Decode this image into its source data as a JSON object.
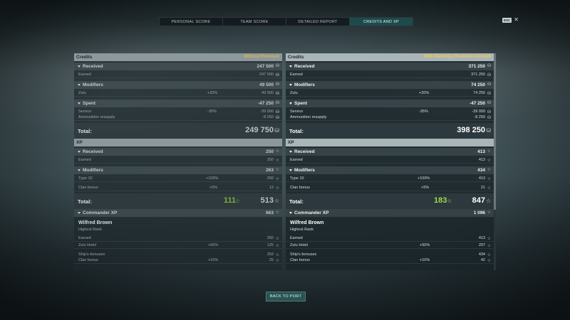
{
  "tabs": [
    "PERSONAL SCORE",
    "TEAM SCORE",
    "DETAILED REPORT",
    "CREDITS AND XP"
  ],
  "active_tab": 3,
  "close": {
    "key": "ESC",
    "icon": "close-icon",
    "symbol": "✕"
  },
  "icons": {
    "credits": "credits-icon",
    "xp": "star-icon"
  },
  "colors": {
    "premium_tag": "#f0c94a",
    "bonus_xp": "#9ed84a",
    "active_tab": "#1d4a4a"
  },
  "left": {
    "credits_header": "Credits",
    "credits_tag": "Without Premium",
    "received": {
      "label": "Received",
      "value": "247 500"
    },
    "earned": {
      "label": "Earned",
      "value": "247 500"
    },
    "modifiers": {
      "label": "Modifiers",
      "value": "49 500"
    },
    "zulu": {
      "label": "Zulu",
      "pct": "+20%",
      "value": "49 500"
    },
    "spent": {
      "label": "Spent",
      "value": "-47 250"
    },
    "service": {
      "label": "Service",
      "pct": "-35%",
      "value": "-39 000"
    },
    "ammo": {
      "label": "Ammunition resupply",
      "value": "-8 250"
    },
    "credits_total": {
      "label": "Total:",
      "value": "249 750"
    },
    "xp_header": "XP",
    "xp_received": {
      "label": "Received",
      "value": "250"
    },
    "xp_earned": {
      "label": "Earned",
      "value": "250"
    },
    "xp_modifiers": {
      "label": "Modifiers",
      "value": "263"
    },
    "type10": {
      "label": "Type 10",
      "pct": "+100%",
      "value": "250"
    },
    "clan": {
      "label": "Clan bonus",
      "pct": "+5%",
      "value": "13"
    },
    "xp_total": {
      "label": "Total:",
      "bonus": "111",
      "value": "513"
    },
    "cmd": {
      "label": "Commander XP",
      "value": "663"
    },
    "cmd_name": "Wilfred Brown",
    "cmd_rank": "Highest Rank",
    "cmd_earned": {
      "label": "Earned",
      "value": "250"
    },
    "cmd_zulu": {
      "label": "Zulu Hotel",
      "pct": "+50%",
      "value": "125"
    },
    "ship_bonus": {
      "label": "Ship's bonuses",
      "value": "263"
    },
    "cmd_clan": {
      "label": "Clan bonus",
      "pct": "+10%",
      "value": "25"
    }
  },
  "right": {
    "credits_header": "Credits",
    "credits_tag": "With Warships Premium Account",
    "received": {
      "label": "Received",
      "value": "371 250"
    },
    "earned": {
      "label": "Earned",
      "value": "371 250"
    },
    "modifiers": {
      "label": "Modifiers",
      "value": "74 250"
    },
    "zulu": {
      "label": "Zulu",
      "pct": "+20%",
      "value": "74 250"
    },
    "spent": {
      "label": "Spent",
      "value": "-47 250"
    },
    "service": {
      "label": "Service",
      "pct": "-35%",
      "value": "-39 000"
    },
    "ammo": {
      "label": "Ammunition resupply",
      "value": "-8 250"
    },
    "credits_total": {
      "label": "Total:",
      "value": "398 250"
    },
    "xp_header": "XP",
    "xp_received": {
      "label": "Received",
      "value": "413"
    },
    "xp_earned": {
      "label": "Earned",
      "value": "413"
    },
    "xp_modifiers": {
      "label": "Modifiers",
      "value": "434"
    },
    "type10": {
      "label": "Type 10",
      "pct": "+100%",
      "value": "413"
    },
    "clan": {
      "label": "Clan bonus",
      "pct": "+5%",
      "value": "21"
    },
    "xp_total": {
      "label": "Total:",
      "bonus": "183",
      "value": "847"
    },
    "cmd": {
      "label": "Commander XP",
      "value": "1 096"
    },
    "cmd_name": "Wilfred Brown",
    "cmd_rank": "Highest Rank",
    "cmd_earned": {
      "label": "Earned",
      "value": "413"
    },
    "cmd_zulu": {
      "label": "Zulu Hotel",
      "pct": "+50%",
      "value": "207"
    },
    "ship_bonus": {
      "label": "Ship's bonuses",
      "value": "434"
    },
    "cmd_clan": {
      "label": "Clan bonus",
      "pct": "+10%",
      "value": "42"
    }
  },
  "back_button": "BACK TO PORT"
}
